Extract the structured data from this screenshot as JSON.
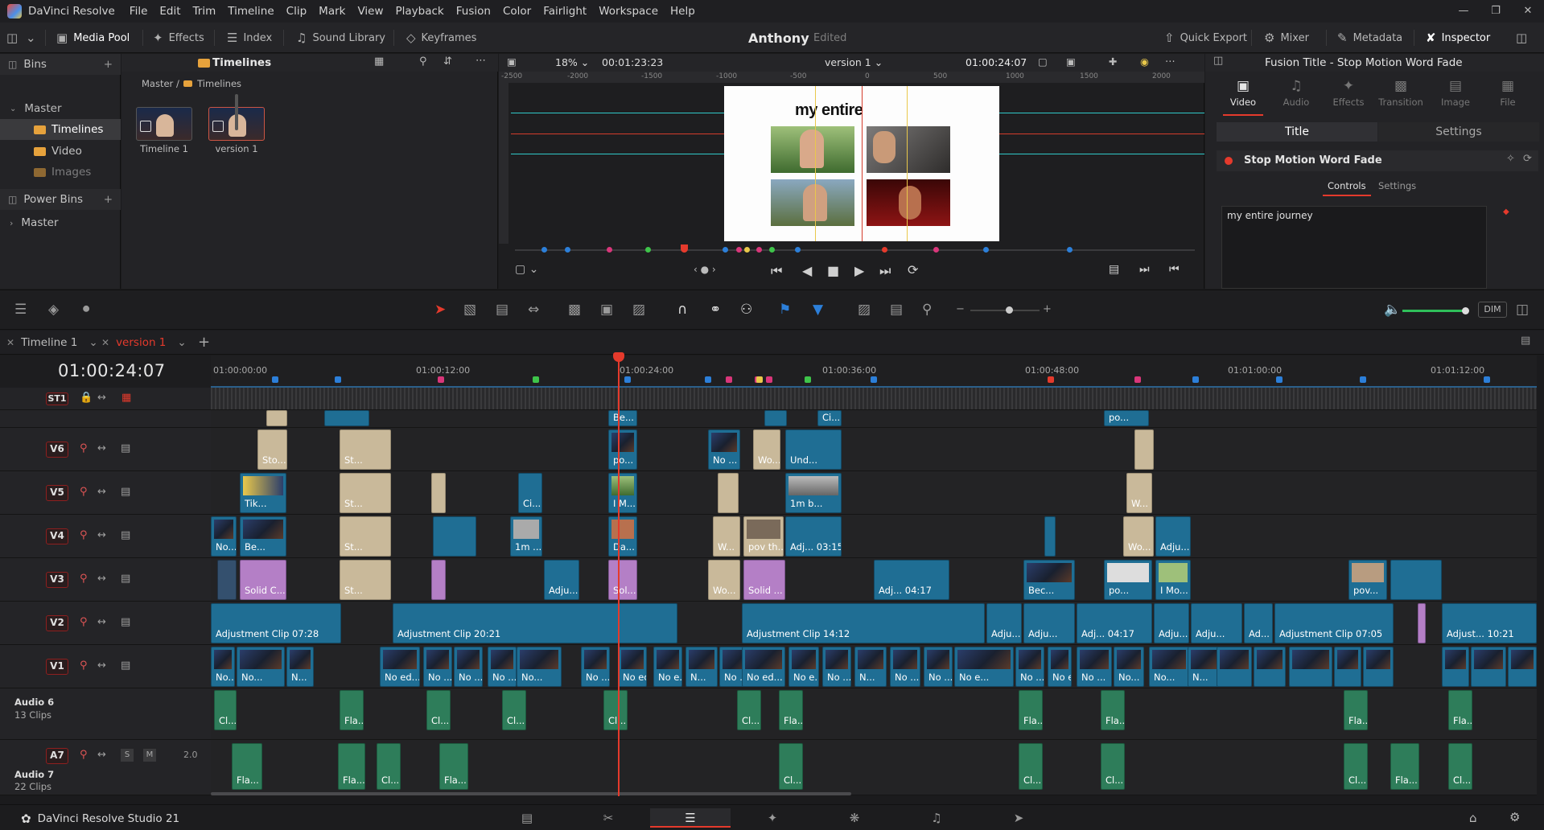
{
  "menu": {
    "app": "DaVinci Resolve",
    "items": [
      "File",
      "Edit",
      "Trim",
      "Timeline",
      "Clip",
      "Mark",
      "View",
      "Playback",
      "Fusion",
      "Color",
      "Fairlight",
      "Workspace",
      "Help"
    ]
  },
  "toolbar": {
    "media_pool": "Media Pool",
    "effects": "Effects",
    "index": "Index",
    "sound_library": "Sound Library",
    "keyframes": "Keyframes",
    "project_title": "Anthony",
    "project_status": "Edited",
    "quick_export": "Quick Export",
    "mixer": "Mixer",
    "metadata": "Metadata",
    "inspector": "Inspector"
  },
  "bins": {
    "header": "Bins",
    "master": "Master",
    "timelines": "Timelines",
    "video": "Video",
    "images": "Images",
    "power_bins": "Power Bins",
    "power_master": "Master"
  },
  "media": {
    "folder": "Timelines",
    "breadcrumb_root": "Master",
    "breadcrumb_sep": "/",
    "breadcrumb_leaf": "Timelines",
    "clips": [
      {
        "label": "Timeline 1"
      },
      {
        "label": "version 1"
      }
    ]
  },
  "viewer": {
    "zoom": "18%",
    "duration": "00:01:23:23",
    "timeline_name": "version 1",
    "timecode": "01:00:24:07",
    "title_text": "my entire",
    "ruler": [
      "-2500",
      "-2000",
      "-1500",
      "-1000",
      "-500",
      "0",
      "500",
      "1000",
      "1500",
      "2000"
    ]
  },
  "inspector": {
    "title": "Fusion Title - Stop Motion Word Fade",
    "tabs": [
      "Video",
      "Audio",
      "Effects",
      "Transition",
      "Image",
      "File"
    ],
    "seg_title": "Title",
    "seg_settings": "Settings",
    "effect_name": "Stop Motion Word Fade",
    "sub_controls": "Controls",
    "sub_settings": "Settings",
    "text_value": "my entire journey"
  },
  "timeline_tabs": {
    "tab1": "Timeline 1",
    "tab2": "version 1",
    "dim": "DIM"
  },
  "timeline": {
    "timecode": "01:00:24:07",
    "ruler_labels": [
      "01:00:00:00",
      "01:00:12:00",
      "01:00:24:00",
      "01:00:36:00",
      "01:00:48:00",
      "01:01:00:00",
      "01:01:12:00"
    ],
    "tracks": [
      {
        "name": "ST1"
      },
      {
        "name": "V6"
      },
      {
        "name": "V5"
      },
      {
        "name": "V4"
      },
      {
        "name": "V3"
      },
      {
        "name": "V2"
      },
      {
        "name": "V1"
      }
    ],
    "audio6": {
      "name": "Audio 6",
      "clips": "13 Clips"
    },
    "audio7": {
      "name": "Audio 7",
      "clips": "22 Clips",
      "tag": "A7",
      "vol": "2.0",
      "s": "S",
      "m": "M"
    },
    "clip_labels": {
      "v2_a": "Adjustment Clip  07:28",
      "v2_b": "Adjustment Clip  20:21",
      "v2_c": "Adjustment Clip  14:12",
      "v2_d": "Adju...",
      "v2_e": "Adju...",
      "v2_f": "Adj...  04:17",
      "v2_g": "Adju...",
      "v2_h": "Adju...",
      "v2_i": "Ad...",
      "v2_j": "Adjustment Clip  07:05",
      "v2_k": "Adjust...  10:21",
      "v3_a": "Solid C...",
      "v3_b": "St...",
      "v3_c": "Adju...",
      "v3_d": "Sol...",
      "v3_e": "Wo...",
      "v3_f": "Solid ...",
      "v3_g": "Adj...  04:17",
      "v3_h": "Bec...",
      "v3_i": "po...",
      "v3_j": "I Mo...",
      "v3_k": "pov...",
      "v4_a": "No...",
      "v4_b": "Be...",
      "v4_c": "St...",
      "v4_d": "1m ...",
      "v4_e": "Da...",
      "v4_f": "W...",
      "v4_g": "pov th...",
      "v4_h": "Adj...  03:15",
      "v4_i": "Wo...",
      "v4_j": "Adju...",
      "v5_a": "Tik...",
      "v5_b": "St...",
      "v5_c": "Ci...",
      "v5_d": "I M...",
      "v5_e": "1m b...",
      "v5_f": "W...",
      "v6_a": "Sto...",
      "v6_b": "St...",
      "v6_c": "po...",
      "v6_d": "No ...",
      "v6_e": "Wo...",
      "v6_f": "Und...",
      "v7_a": "Be...",
      "v7_b": "Ci...",
      "v7_c": "po...",
      "v1": [
        "No...",
        "No...",
        "N...",
        "No ed...",
        "No ...",
        "No ...",
        "No ...",
        "No...",
        "No ...",
        "No ed...",
        "No e...",
        "N...",
        "No ...",
        "No ed...",
        "No e...",
        "No ...",
        "N...",
        "No ...",
        "No ...",
        "No e...",
        "No ...",
        "No e...",
        "No ...",
        "No...",
        "No...",
        "N..."
      ],
      "a6": [
        "Cl...",
        "Fla...",
        "Cl...",
        "Cl...",
        "Cl...",
        "Cl...",
        "Fla...",
        "Fla...",
        "Fla...",
        "Fla...",
        "Fla..."
      ],
      "a7": [
        "Fla...",
        "Fla...",
        "Cl...",
        "Fla...",
        "Cl...",
        "Cl...",
        "Cl...",
        "Cl...",
        "Fla...",
        "Cl..."
      ]
    }
  },
  "status": {
    "brand": "DaVinci Resolve Studio 21"
  },
  "colors": {
    "accent_red": "#e53a2c",
    "clip_blue": "#1f6e94",
    "clip_tan": "#c9b99a",
    "clip_pink": "#b47fc6",
    "audio_green": "#2e7d5a"
  }
}
